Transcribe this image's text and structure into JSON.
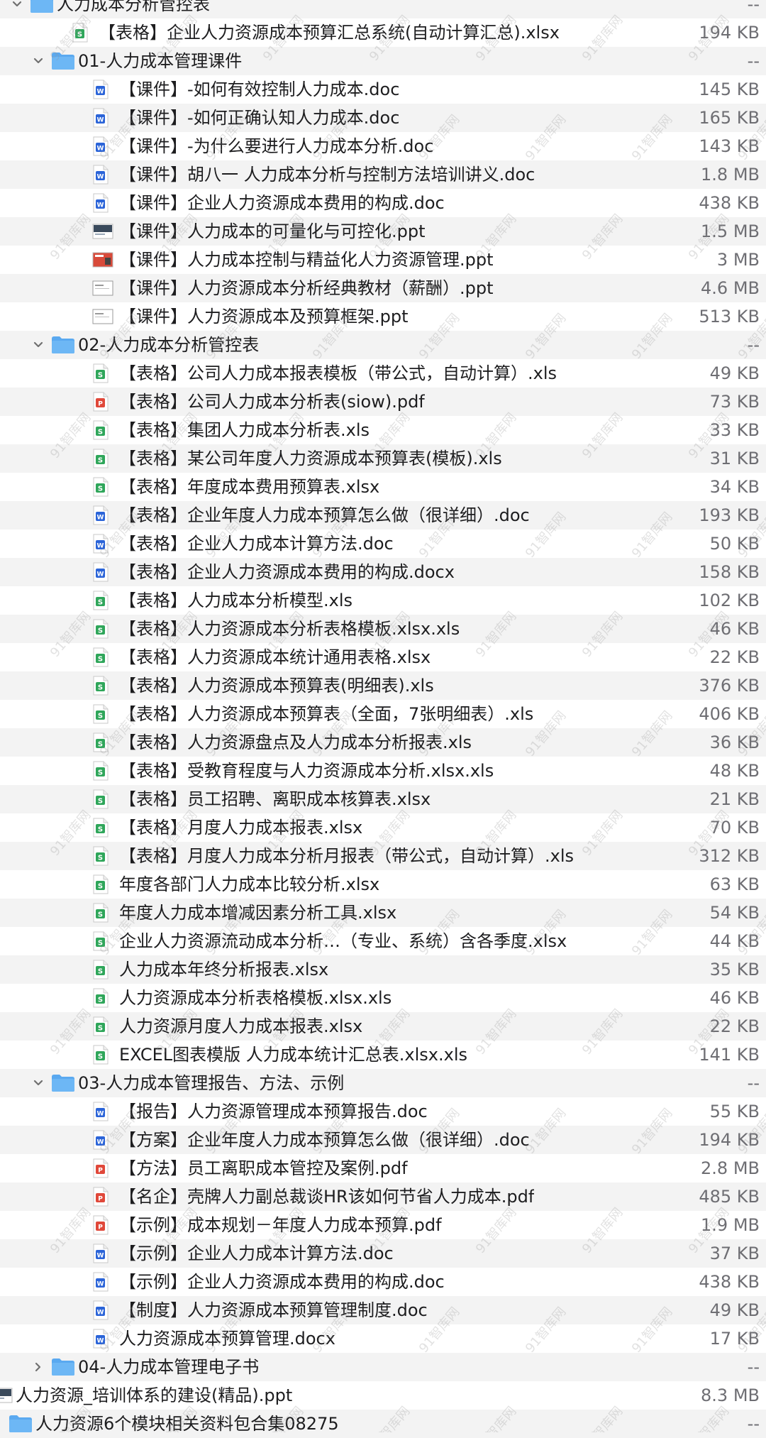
{
  "colors": {
    "folder": "#5aa9f0",
    "excel": "#2fa65a",
    "word": "#2b64d8",
    "pdf": "#e0483a",
    "ppt_dark": "#3a4a5c",
    "ppt_red": "#d84a3a",
    "ppt_gray": "#9a9a9a",
    "size_text": "#6e6e73",
    "stripe": "#f3f3f3",
    "watermark": "#bcbcbc"
  },
  "watermark_text": "91智库网",
  "rows": [
    {
      "name": "人力成本分析管控表",
      "size": "--",
      "level": 0,
      "kind": "folder",
      "expanded": true
    },
    {
      "name": "【表格】企业人力资源成本预算汇总系统(自动计算汇总).xlsx",
      "size": "194 KB",
      "level": 1,
      "kind": "excel"
    },
    {
      "name": "01-人力成本管理课件",
      "size": "--",
      "level": 1,
      "kind": "folder",
      "expanded": true
    },
    {
      "name": "【课件】-如何有效控制人力成本.doc",
      "size": "145 KB",
      "level": 2,
      "kind": "word"
    },
    {
      "name": "【课件】-如何正确认知人力成本.doc",
      "size": "165 KB",
      "level": 2,
      "kind": "word"
    },
    {
      "name": "【课件】-为什么要进行人力成本分析.doc",
      "size": "143 KB",
      "level": 2,
      "kind": "word"
    },
    {
      "name": "【课件】胡八一 人力成本分析与控制方法培训讲义.doc",
      "size": "1.8 MB",
      "level": 2,
      "kind": "word"
    },
    {
      "name": "【课件】企业人力资源成本费用的构成.doc",
      "size": "438 KB",
      "level": 2,
      "kind": "word"
    },
    {
      "name": "【课件】人力成本的可量化与可控化.ppt",
      "size": "1.5 MB",
      "level": 2,
      "kind": "ppt-dark"
    },
    {
      "name": "【课件】人力成本控制与精益化人力资源管理.ppt",
      "size": "3 MB",
      "level": 2,
      "kind": "ppt-red"
    },
    {
      "name": "【课件】人力资源成本分析经典教材（薪酬）.ppt",
      "size": "4.6 MB",
      "level": 2,
      "kind": "ppt-light"
    },
    {
      "name": "【课件】人力资源成本及预算框架.ppt",
      "size": "513 KB",
      "level": 2,
      "kind": "ppt-light"
    },
    {
      "name": "02-人力成本分析管控表",
      "size": "--",
      "level": 1,
      "kind": "folder",
      "expanded": true
    },
    {
      "name": "【表格】公司人力成本报表模板（带公式，自动计算）.xls",
      "size": "49 KB",
      "level": 2,
      "kind": "excel"
    },
    {
      "name": "【表格】公司人力成本分析表(siow).pdf",
      "size": "73 KB",
      "level": 2,
      "kind": "pdf"
    },
    {
      "name": "【表格】集团人力成本分析表.xls",
      "size": "33 KB",
      "level": 2,
      "kind": "excel"
    },
    {
      "name": "【表格】某公司年度人力资源成本预算表(模板).xls",
      "size": "31 KB",
      "level": 2,
      "kind": "excel"
    },
    {
      "name": "【表格】年度成本费用预算表.xlsx",
      "size": "34 KB",
      "level": 2,
      "kind": "excel"
    },
    {
      "name": "【表格】企业年度人力成本预算怎么做（很详细）.doc",
      "size": "193 KB",
      "level": 2,
      "kind": "word"
    },
    {
      "name": "【表格】企业人力成本计算方法.doc",
      "size": "50 KB",
      "level": 2,
      "kind": "word"
    },
    {
      "name": "【表格】企业人力资源成本费用的构成.docx",
      "size": "158 KB",
      "level": 2,
      "kind": "word"
    },
    {
      "name": "【表格】人力成本分析模型.xls",
      "size": "102 KB",
      "level": 2,
      "kind": "excel"
    },
    {
      "name": "【表格】人力资源成本分析表格模板.xlsx.xls",
      "size": "46 KB",
      "level": 2,
      "kind": "excel"
    },
    {
      "name": "【表格】人力资源成本统计通用表格.xlsx",
      "size": "22 KB",
      "level": 2,
      "kind": "excel"
    },
    {
      "name": "【表格】人力资源成本预算表(明细表).xls",
      "size": "376 KB",
      "level": 2,
      "kind": "excel"
    },
    {
      "name": "【表格】人力资源成本预算表（全面，7张明细表）.xls",
      "size": "406 KB",
      "level": 2,
      "kind": "excel"
    },
    {
      "name": "【表格】人力资源盘点及人力成本分析报表.xls",
      "size": "36 KB",
      "level": 2,
      "kind": "excel"
    },
    {
      "name": "【表格】受教育程度与人力资源成本分析.xlsx.xls",
      "size": "48 KB",
      "level": 2,
      "kind": "excel"
    },
    {
      "name": "【表格】员工招聘、离职成本核算表.xlsx",
      "size": "21 KB",
      "level": 2,
      "kind": "excel"
    },
    {
      "name": "【表格】月度人力成本报表.xlsx",
      "size": "70 KB",
      "level": 2,
      "kind": "excel"
    },
    {
      "name": "【表格】月度人力成本分析月报表（带公式，自动计算）.xls",
      "size": "312 KB",
      "level": 2,
      "kind": "excel"
    },
    {
      "name": "年度各部门人力成本比较分析.xlsx",
      "size": "63 KB",
      "level": 2,
      "kind": "excel"
    },
    {
      "name": "年度人力成本增减因素分析工具.xlsx",
      "size": "54 KB",
      "level": 2,
      "kind": "excel"
    },
    {
      "name": "企业人力资源流动成本分析…（专业、系统）含各季度.xlsx",
      "size": "44 KB",
      "level": 2,
      "kind": "excel"
    },
    {
      "name": "人力成本年终分析报表.xlsx",
      "size": "35 KB",
      "level": 2,
      "kind": "excel"
    },
    {
      "name": "人力资源成本分析表格模板.xlsx.xls",
      "size": "46 KB",
      "level": 2,
      "kind": "excel"
    },
    {
      "name": "人力资源月度人力成本报表.xlsx",
      "size": "22 KB",
      "level": 2,
      "kind": "excel"
    },
    {
      "name": "EXCEL图表模版 人力成本统计汇总表.xlsx.xls",
      "size": "141 KB",
      "level": 2,
      "kind": "excel"
    },
    {
      "name": "03-人力成本管理报告、方法、示例",
      "size": "--",
      "level": 1,
      "kind": "folder",
      "expanded": true
    },
    {
      "name": "【报告】人力资源管理成本预算报告.doc",
      "size": "55 KB",
      "level": 2,
      "kind": "word"
    },
    {
      "name": "【方案】企业年度人力成本预算怎么做（很详细）.doc",
      "size": "194 KB",
      "level": 2,
      "kind": "word"
    },
    {
      "name": "【方法】员工离职成本管控及案例.pdf",
      "size": "2.8 MB",
      "level": 2,
      "kind": "pdf"
    },
    {
      "name": "【名企】壳牌人力副总裁谈HR该如何节省人力成本.pdf",
      "size": "485 KB",
      "level": 2,
      "kind": "pdf"
    },
    {
      "name": "【示例】成本规划－年度人力成本预算.pdf",
      "size": "1.9 MB",
      "level": 2,
      "kind": "pdf"
    },
    {
      "name": "【示例】企业人力成本计算方法.doc",
      "size": "37 KB",
      "level": 2,
      "kind": "word"
    },
    {
      "name": "【示例】企业人力资源成本费用的构成.doc",
      "size": "438 KB",
      "level": 2,
      "kind": "word"
    },
    {
      "name": "【制度】人力资源成本预算管理制度.doc",
      "size": "49 KB",
      "level": 2,
      "kind": "word"
    },
    {
      "name": "人力资源成本预算管理.docx",
      "size": "17 KB",
      "level": 2,
      "kind": "word"
    },
    {
      "name": "04-人力成本管理电子书",
      "size": "--",
      "level": 1,
      "kind": "folder",
      "expanded": false
    },
    {
      "name": "人力资源_培训体系的建设(精品).ppt",
      "size": "8.3 MB",
      "level": -1,
      "kind": "ppt-dark"
    },
    {
      "name": "人力资源6个模块相关资料包合集08275",
      "size": "--",
      "level": -1,
      "kind": "folder",
      "expanded": false
    }
  ]
}
